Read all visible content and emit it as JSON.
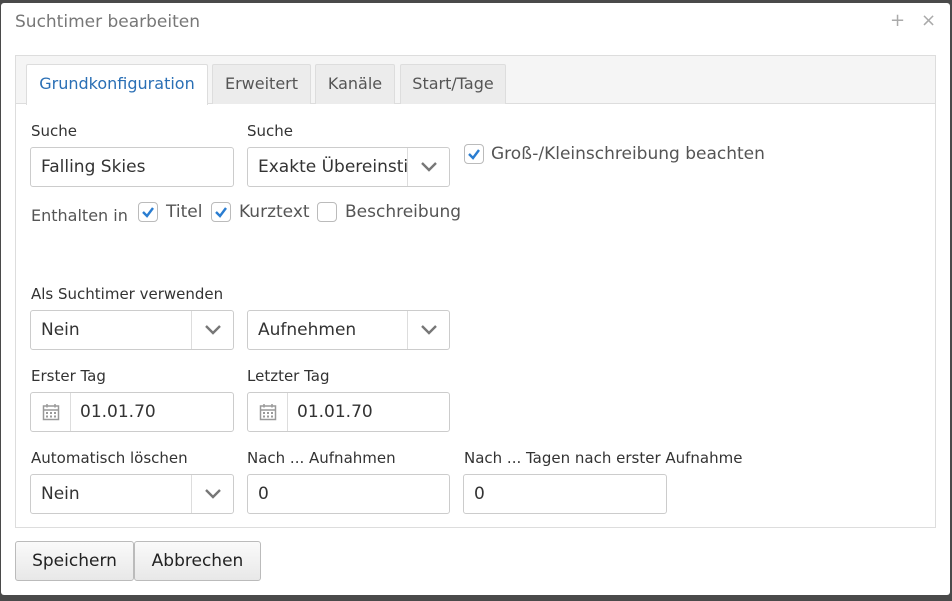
{
  "dialog": {
    "title": "Suchtimer bearbeiten",
    "add_glyph": "+",
    "close_glyph": "×"
  },
  "tabs": [
    {
      "label": "Grundkonfiguration",
      "active": true
    },
    {
      "label": "Erweitert",
      "active": false
    },
    {
      "label": "Kanäle",
      "active": false
    },
    {
      "label": "Start/Tage",
      "active": false
    }
  ],
  "form": {
    "search": {
      "label": "Suche",
      "value": "Falling Skies"
    },
    "search_mode": {
      "label": "Suche",
      "value": "Exakte Übereinstimmung"
    },
    "case_sensitive": {
      "label": "Groß-/Kleinschreibung beachten",
      "checked": true
    },
    "contained_in": {
      "label": "Enthalten in",
      "options": [
        {
          "label": "Titel",
          "checked": true
        },
        {
          "label": "Kurztext",
          "checked": true
        },
        {
          "label": "Beschreibung",
          "checked": false
        }
      ]
    },
    "use_as": {
      "label": "Als Suchtimer verwenden",
      "value": "Nein",
      "action": "Aufnehmen"
    },
    "first_day": {
      "label": "Erster Tag",
      "value": "01.01.70"
    },
    "last_day": {
      "label": "Letzter Tag",
      "value": "01.01.70"
    },
    "auto_delete": {
      "label": "Automatisch löschen",
      "value": "Nein"
    },
    "after_recordings": {
      "label": "Nach ... Aufnahmen",
      "value": "0"
    },
    "after_days": {
      "label": "Nach ... Tagen nach erster Aufnahme",
      "value": "0"
    }
  },
  "buttons": {
    "save": "Speichern",
    "cancel": "Abbrechen"
  },
  "colors": {
    "accent": "#2a6fb5",
    "checkmark": "#2a7dd1"
  }
}
